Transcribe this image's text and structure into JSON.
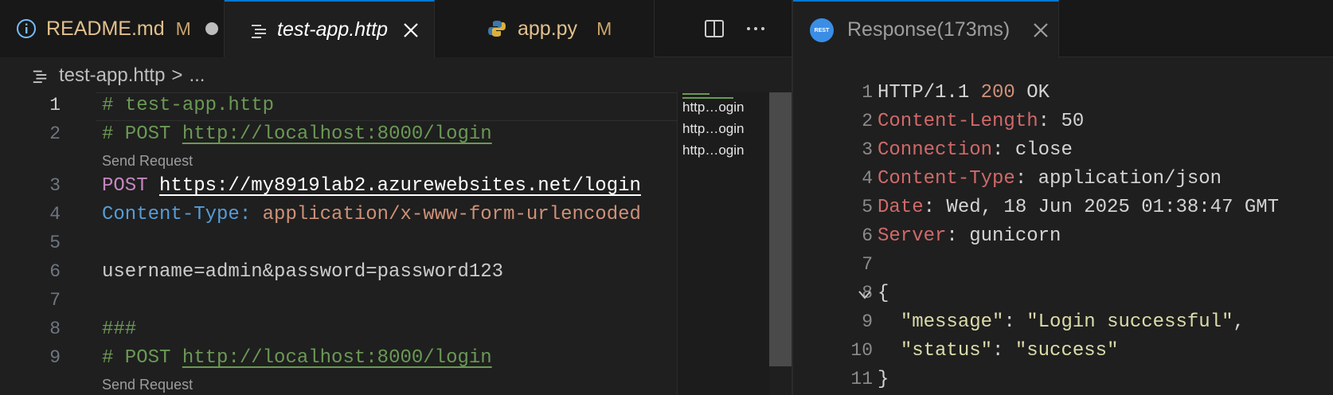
{
  "left_tabs": [
    {
      "label": "README.md",
      "badge": "M"
    },
    {
      "label": "test-app.http"
    },
    {
      "label": "app.py",
      "badge": "M"
    }
  ],
  "icons": {
    "info": "info-icon",
    "file_lines": "file-lines-icon",
    "python": "python-icon",
    "close": "close-icon",
    "split": "split-editor-icon",
    "more": "more-icon",
    "rest_client": "rest-client-icon",
    "chevron": "chevron-down-icon"
  },
  "breadcrumb": {
    "file": "test-app.http",
    "separator": ">",
    "rest": "..."
  },
  "editor": {
    "line_numbers": [
      "1",
      "2",
      "3",
      "4",
      "5",
      "6",
      "7",
      "8",
      "9"
    ],
    "l1": "# test-app.http",
    "l2_prefix": "# POST ",
    "l2_url": "http://localhost:8000/login",
    "codelens_1": "Send Request",
    "l3_method": "POST",
    "l3_url": "https://my8919lab2.azurewebsites.net/login",
    "l4_key": "Content-Type:",
    "l4_value": " application/x-www-form-urlencoded",
    "l6": "username=admin&password=password123",
    "l8": "###",
    "l9_prefix": "# POST ",
    "l9_url": "http://localhost:8000/login",
    "codelens_2": "Send Request"
  },
  "minimap": {
    "items": [
      "http…ogin",
      "http…ogin",
      "http…ogin"
    ]
  },
  "response_tab": {
    "label": "Response(173ms)",
    "badge_text": "REST"
  },
  "response": {
    "line_numbers": [
      "1",
      "2",
      "3",
      "4",
      "5",
      "6",
      "7",
      "8",
      "9",
      "10",
      "11"
    ],
    "status_proto": "HTTP/1.1 ",
    "status_code": "200",
    "status_text": " OK",
    "h1_key": "Content-Length",
    "h1_val": ": 50",
    "h2_key": "Connection",
    "h2_val": ": close",
    "h3_key": "Content-Type",
    "h3_val": ": application/json",
    "h4_key": "Date",
    "h4_val": ": Wed, 18 Jun 2025 01:38:47 GMT",
    "h5_key": "Server",
    "h5_val": ": gunicorn",
    "brace_open": "{",
    "j1_indent": "  ",
    "j1_key": "\"message\"",
    "j1_colon": ": ",
    "j1_val": "\"Login successful\"",
    "j1_comma": ",",
    "j2_indent": "  ",
    "j2_key": "\"status\"",
    "j2_colon": ": ",
    "j2_val": "\"success\"",
    "brace_close": "}"
  }
}
